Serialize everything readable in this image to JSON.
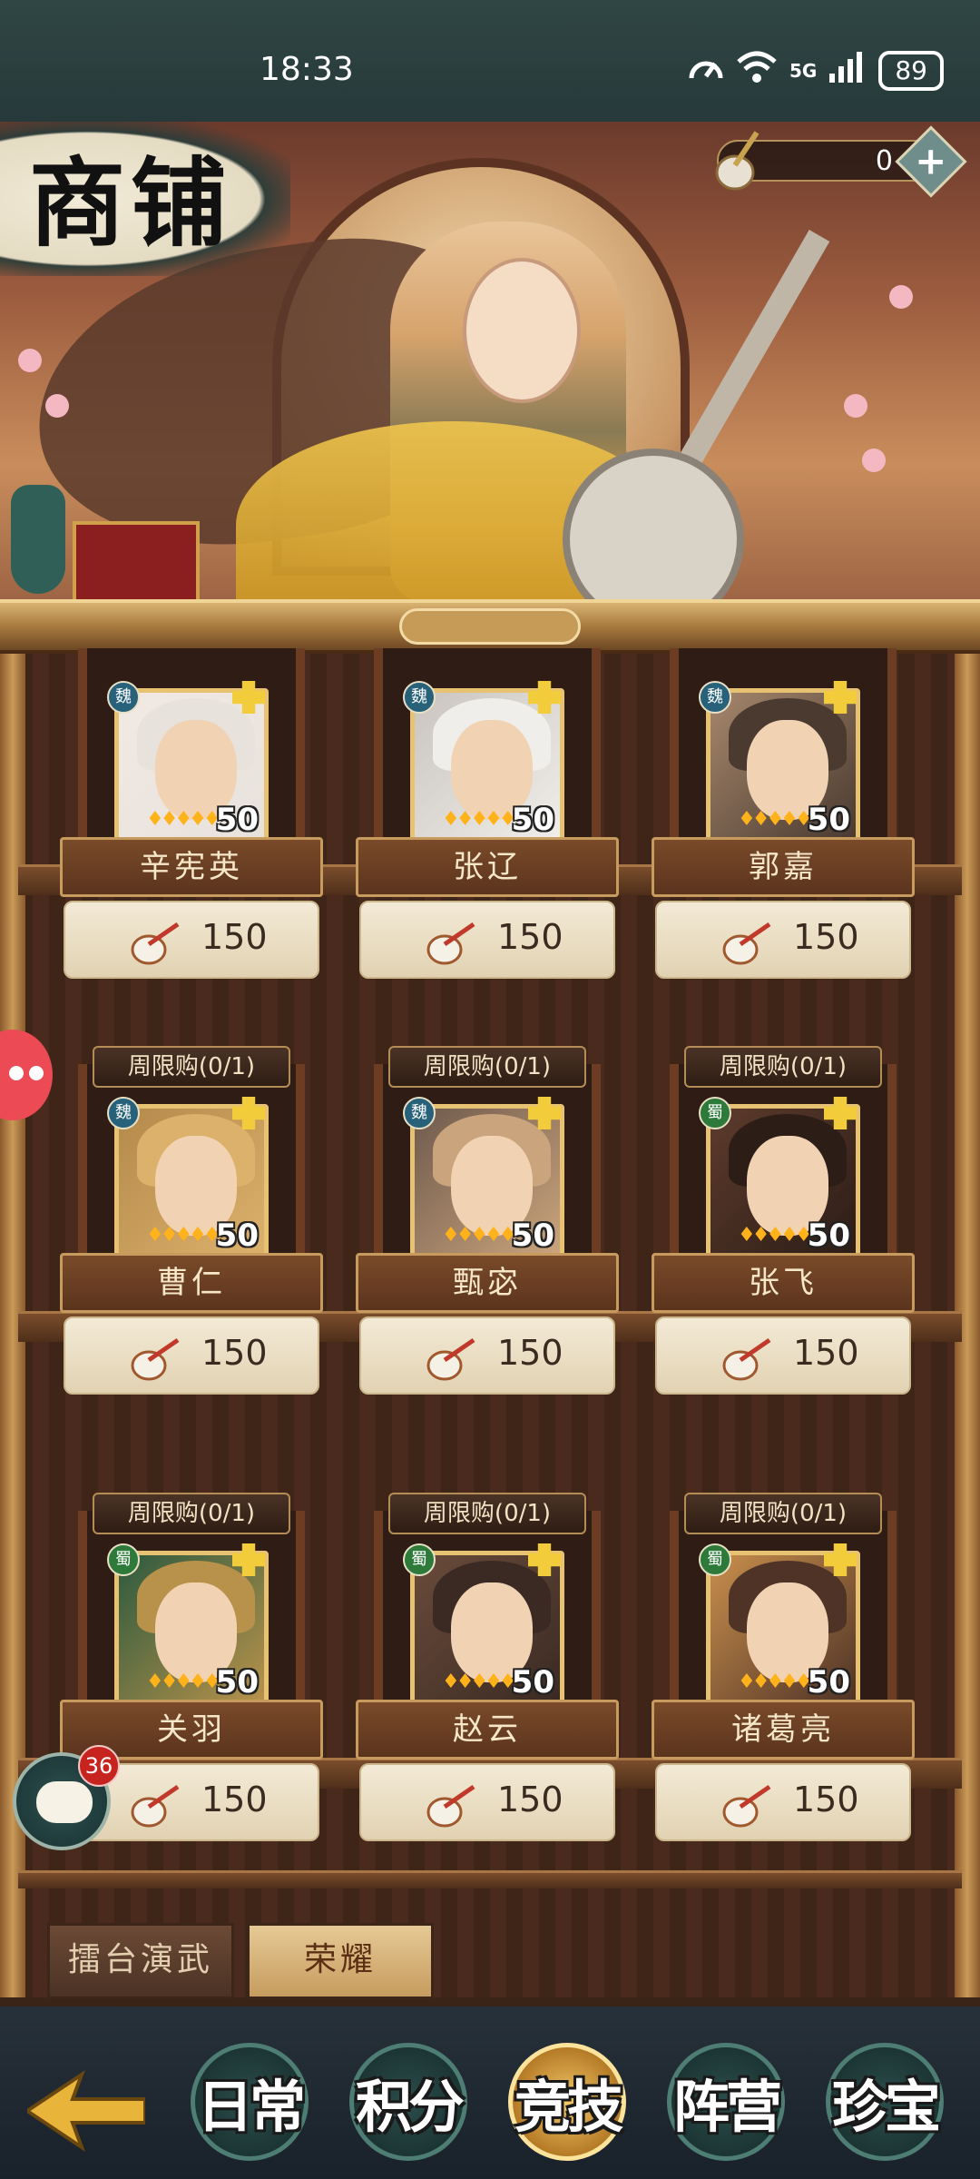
{
  "status_bar": {
    "time": "18:33",
    "network": "5G",
    "battery": "89"
  },
  "page": {
    "title": "商铺",
    "currency_value": "0",
    "add_currency_symbol": "+"
  },
  "items": [
    {
      "name": "辛宪英",
      "price": "150",
      "faction": "魏",
      "level": "50",
      "limit": ""
    },
    {
      "name": "张辽",
      "price": "150",
      "faction": "魏",
      "level": "50",
      "limit": ""
    },
    {
      "name": "郭嘉",
      "price": "150",
      "faction": "魏",
      "level": "50",
      "limit": ""
    },
    {
      "name": "曹仁",
      "price": "150",
      "faction": "魏",
      "level": "50",
      "limit": "周限购(0/1)"
    },
    {
      "name": "甄宓",
      "price": "150",
      "faction": "魏",
      "level": "50",
      "limit": "周限购(0/1)"
    },
    {
      "name": "张飞",
      "price": "150",
      "faction": "蜀",
      "level": "50",
      "limit": "周限购(0/1)"
    },
    {
      "name": "关羽",
      "price": "150",
      "faction": "蜀",
      "level": "50",
      "limit": "周限购(0/1)"
    },
    {
      "name": "赵云",
      "price": "150",
      "faction": "蜀",
      "level": "50",
      "limit": "周限购(0/1)"
    },
    {
      "name": "诸葛亮",
      "price": "150",
      "faction": "蜀",
      "level": "50",
      "limit": "周限购(0/1)"
    }
  ],
  "sub_tabs": [
    {
      "label": "擂台演武",
      "active": false
    },
    {
      "label": "荣耀",
      "active": true
    }
  ],
  "nav": [
    {
      "label": "日常",
      "active": false
    },
    {
      "label": "积分",
      "active": false
    },
    {
      "label": "竞技",
      "active": true
    },
    {
      "label": "阵营",
      "active": false
    },
    {
      "label": "珍宝",
      "active": false
    }
  ],
  "chat": {
    "badge": "36"
  },
  "colors": {
    "wei": "#27617a",
    "shu": "#2d7a3a",
    "gold": "#e6c272",
    "wood": "#4a2a1d"
  }
}
